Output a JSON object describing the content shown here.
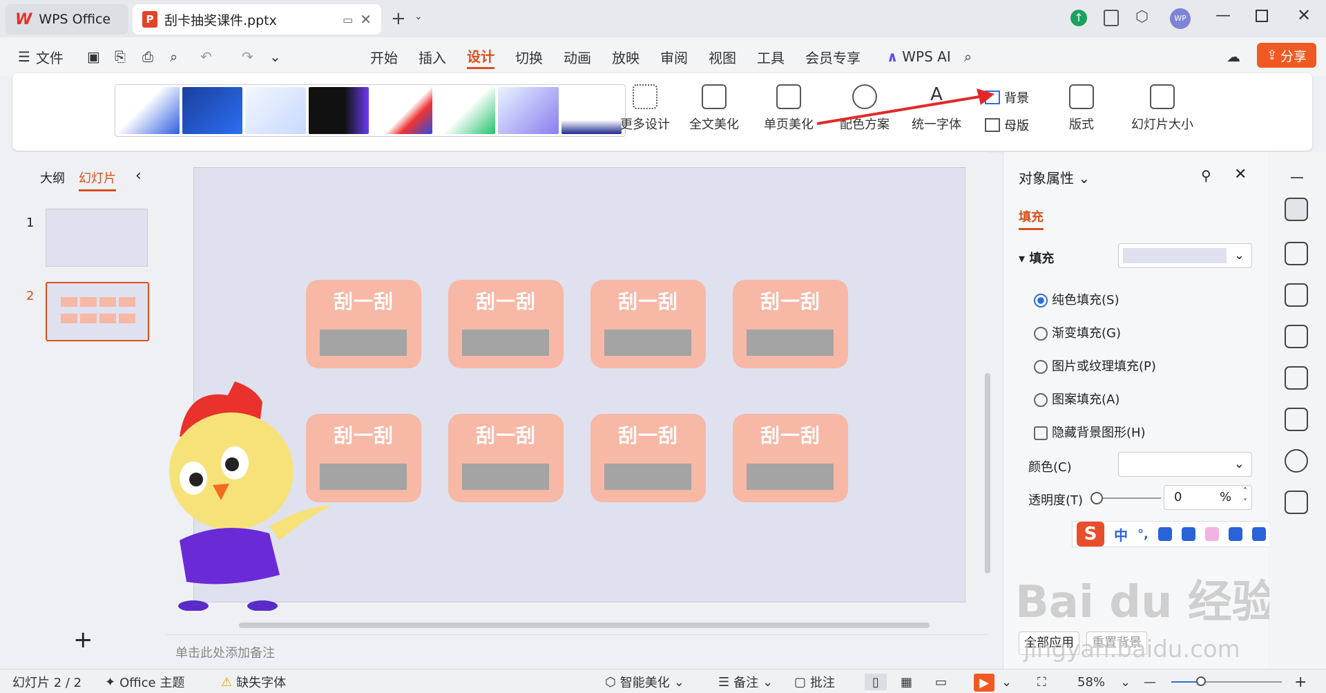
{
  "tabs": {
    "app": "WPS Office",
    "doc": "刮卡抽奖课件.pptx"
  },
  "window": {
    "avatar": "WP"
  },
  "menu": {
    "file": "文件",
    "items": [
      "开始",
      "插入",
      "设计",
      "切换",
      "动画",
      "放映",
      "审阅",
      "视图",
      "工具",
      "会员专享"
    ],
    "active": "设计",
    "ai": "WPS AI",
    "share": "分享"
  },
  "ribbon": {
    "more_design": "更多设计",
    "full_beautify": "全文美化",
    "single_beautify": "单页美化",
    "color_scheme": "配色方案",
    "unify_font": "统一字体",
    "background": "背景",
    "master": "母版",
    "layout": "版式",
    "slide_size": "幻灯片大小"
  },
  "left_panel": {
    "outline": "大纲",
    "slides": "幻灯片",
    "slide1": "1",
    "slide2": "2",
    "add": "+"
  },
  "slide": {
    "card_label": "刮一刮"
  },
  "notes": {
    "placeholder": "单击此处添加备注"
  },
  "prop": {
    "title": "对象属性",
    "tab_fill": "填充",
    "section_fill": "填充",
    "options": [
      "纯色填充(S)",
      "渐变填充(G)",
      "图片或纹理填充(P)",
      "图案填充(A)"
    ],
    "hide_bg": "隐藏背景图形(H)",
    "color_label": "颜色(C)",
    "transparency_label": "透明度(T)",
    "transparency_value": "0",
    "percent": "%",
    "apply_all": "全部应用",
    "reset_bg": "重置背景"
  },
  "ime": {
    "lang": "中",
    "punct": "°,"
  },
  "watermark": {
    "brand": "Bai du 经验",
    "url": "jingyan.baidu.com"
  },
  "status": {
    "slide_count": "幻灯片 2 / 2",
    "theme": "Office 主题",
    "missing_font": "缺失字体",
    "smart_beautify": "智能美化",
    "notes": "备注",
    "comments": "批注",
    "zoom": "58%"
  },
  "colors": {
    "accent": "#d9501c",
    "card": "#f7b8a6",
    "slide_bg": "#dfe1ef",
    "share": "#f05a22"
  }
}
